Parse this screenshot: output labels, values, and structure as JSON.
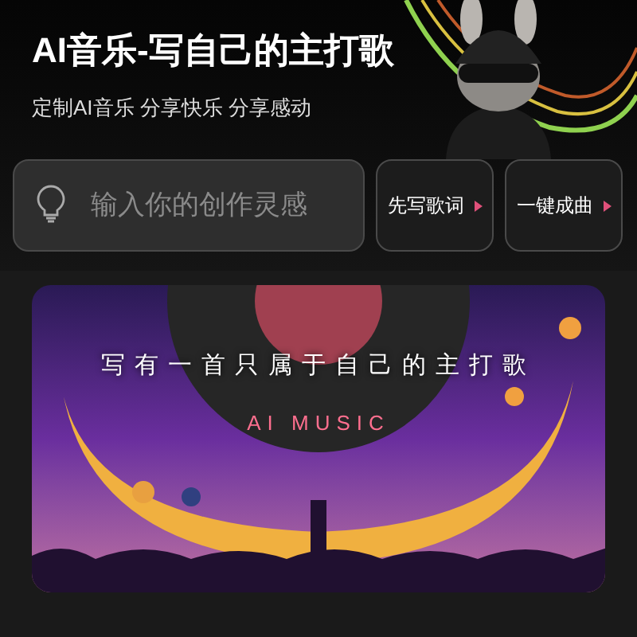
{
  "header": {
    "title": "AI音乐-写自己的主打歌",
    "subtitle": "定制AI音乐 分享快乐 分享感动"
  },
  "prompt": {
    "placeholder": "输入你的创作灵感"
  },
  "actions": [
    {
      "label": "先写歌词"
    },
    {
      "label": "一键成曲"
    }
  ],
  "banner": {
    "headline": "写有一首只属于自己的主打歌",
    "tagline": "AI MUSIC"
  }
}
